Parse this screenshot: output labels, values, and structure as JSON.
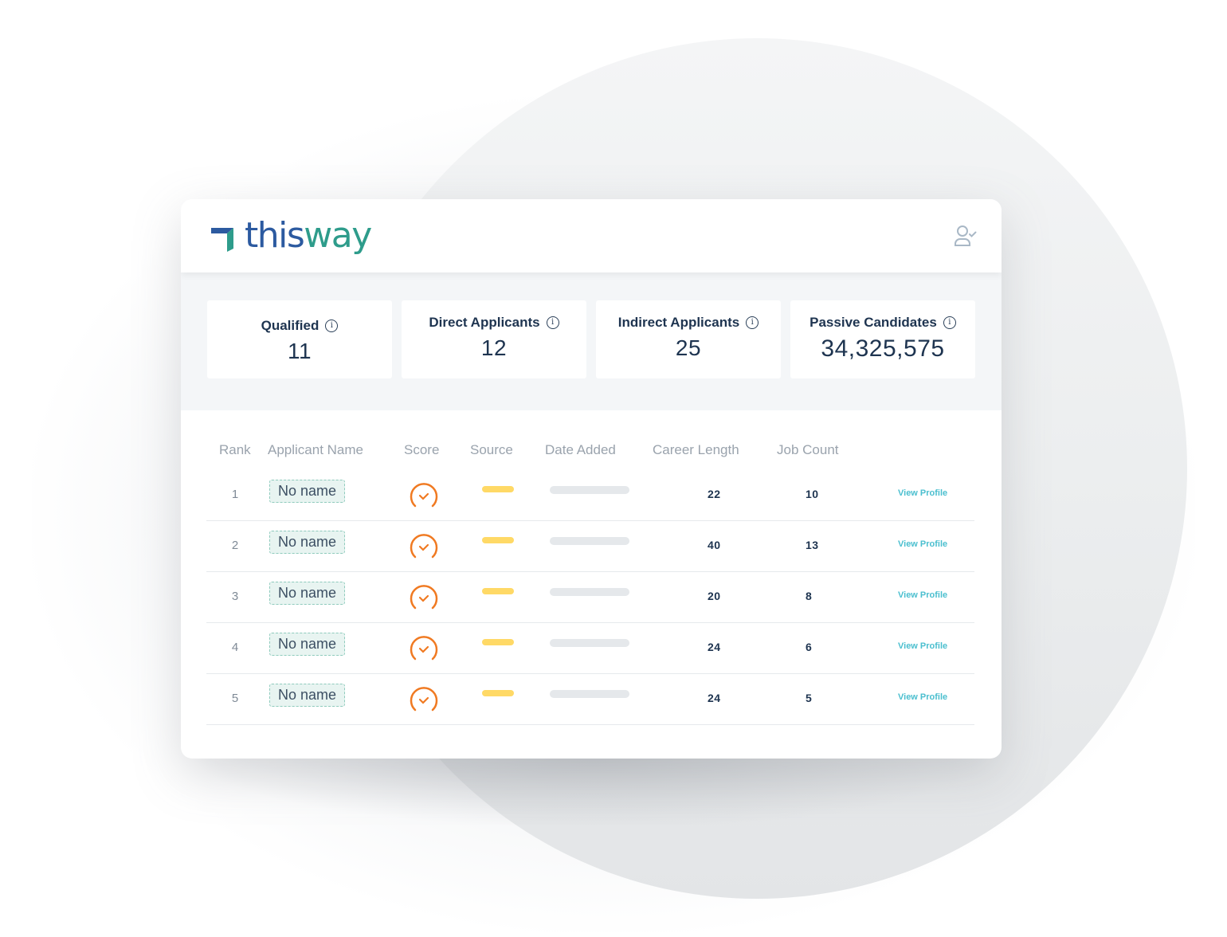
{
  "brand": {
    "name_part1": "this",
    "name_part2": "way",
    "colors": {
      "primary_blue": "#2c5aa0",
      "primary_teal": "#2e9c8b"
    }
  },
  "header": {
    "user_icon": "user-check-icon"
  },
  "stats": [
    {
      "label": "Qualified",
      "value": "11",
      "icon": "info-icon"
    },
    {
      "label": "Direct Applicants",
      "value": "12",
      "icon": "info-icon"
    },
    {
      "label": "Indirect Applicants",
      "value": "25",
      "icon": "info-icon"
    },
    {
      "label": "Passive Candidates",
      "value": "34,325,575",
      "icon": "info-icon"
    }
  ],
  "table": {
    "columns": [
      "Rank",
      "Applicant Name",
      "Score",
      "Source",
      "Date Added",
      "Career Length",
      "Job Count",
      ""
    ],
    "rows": [
      {
        "rank": "1",
        "name": "No name",
        "career_length": "22",
        "job_count": "10",
        "action": "View Profile"
      },
      {
        "rank": "2",
        "name": "No name",
        "career_length": "40",
        "job_count": "13",
        "action": "View Profile"
      },
      {
        "rank": "3",
        "name": "No name",
        "career_length": "20",
        "job_count": "8",
        "action": "View Profile"
      },
      {
        "rank": "4",
        "name": "No name",
        "career_length": "24",
        "job_count": "6",
        "action": "View Profile"
      },
      {
        "rank": "5",
        "name": "No name",
        "career_length": "24",
        "job_count": "5",
        "action": "View Profile"
      }
    ],
    "colors": {
      "score": "#f07a22",
      "source": "#ffd966",
      "link": "#4bbfcf"
    }
  },
  "info_glyph": "i"
}
